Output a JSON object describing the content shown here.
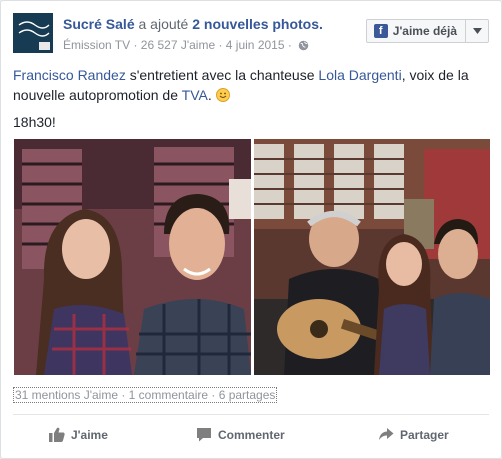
{
  "post": {
    "page_name": "Sucré Salé",
    "action_text": "a ajouté",
    "photos_text": "2 nouvelles photos.",
    "meta": "Émission TV · 26 527 J'aime · 4 juin 2015 ·",
    "like_page_button": "J'aime déjà",
    "avatar_logo_text": "Sucré Salé",
    "avatar_logo_sub": "TVA",
    "text_person1": "Francisco Randez",
    "text_mid1": " s'entretient avec la chanteuse ",
    "text_person2": "Lola Dargenti",
    "text_mid2": ", voix de la nouvelle autopromotion de ",
    "text_tva": "TVA",
    "text_end": ".",
    "time_text": "18h30!"
  },
  "counts": {
    "summary": "31 mentions J'aime · 1 commentaire · 6 partages"
  },
  "actions": {
    "like": "J'aime",
    "comment": "Commenter",
    "share": "Partager"
  },
  "colors": {
    "link": "#365899",
    "meta": "#90949c",
    "action": "#616770"
  }
}
